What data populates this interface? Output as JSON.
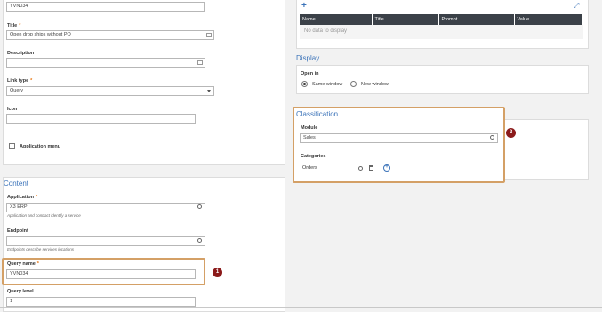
{
  "left_top": {
    "top_field_value": "YVN034",
    "title": {
      "label": "Title",
      "value": "Open drop ships without PO"
    },
    "description": {
      "label": "Description",
      "value": ""
    },
    "link_type": {
      "label": "Link type",
      "value": "Query"
    },
    "icon": {
      "label": "Icon",
      "value": ""
    },
    "application_menu_label": "Application menu"
  },
  "content": {
    "heading": "Content",
    "application": {
      "label": "Application",
      "value": "X3 ERP",
      "hint": "Application and contract identify a service"
    },
    "endpoint": {
      "label": "Endpoint",
      "value": "",
      "hint": "Endpoints describe services locations"
    },
    "query_name": {
      "label": "Query name",
      "value": "YVN034"
    },
    "query_level": {
      "label": "Query level",
      "value": "1"
    }
  },
  "parameters": {
    "columns": [
      "Name",
      "Title",
      "Prompt",
      "Value"
    ],
    "empty_text": "No data to display"
  },
  "display": {
    "heading": "Display",
    "open_in_label": "Open in",
    "options": [
      "Same window",
      "New window"
    ],
    "selected": "Same window"
  },
  "classification": {
    "heading": "Classification",
    "module": {
      "label": "Module",
      "value": "Sales"
    },
    "categories": {
      "label": "Categories",
      "value": "Orders"
    }
  },
  "callouts": [
    "1",
    "2"
  ],
  "colors": {
    "accent": "#3b73b9",
    "required": "#e8710a",
    "callout_border": "#d4a066",
    "badge": "#8b1a1a"
  }
}
